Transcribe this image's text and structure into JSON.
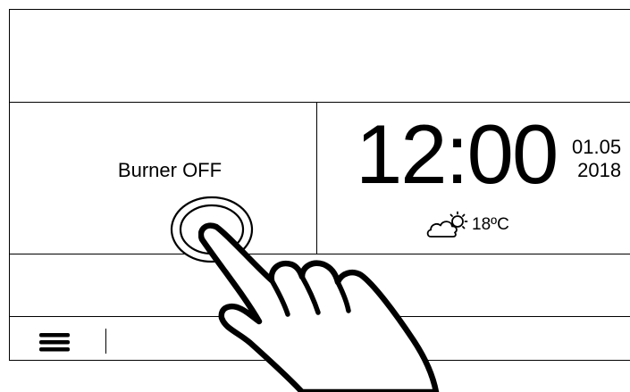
{
  "burner": {
    "status_label": "Burner OFF"
  },
  "clock": {
    "time": "12:00",
    "date_day_month": "01.05",
    "date_year": "2018"
  },
  "weather": {
    "icon": "partly-cloudy-icon",
    "temperature": "18ºC"
  },
  "toolbar": {
    "menu_icon": "hamburger-menu-icon"
  },
  "colors": {
    "foreground": "#000000",
    "background": "#ffffff"
  }
}
